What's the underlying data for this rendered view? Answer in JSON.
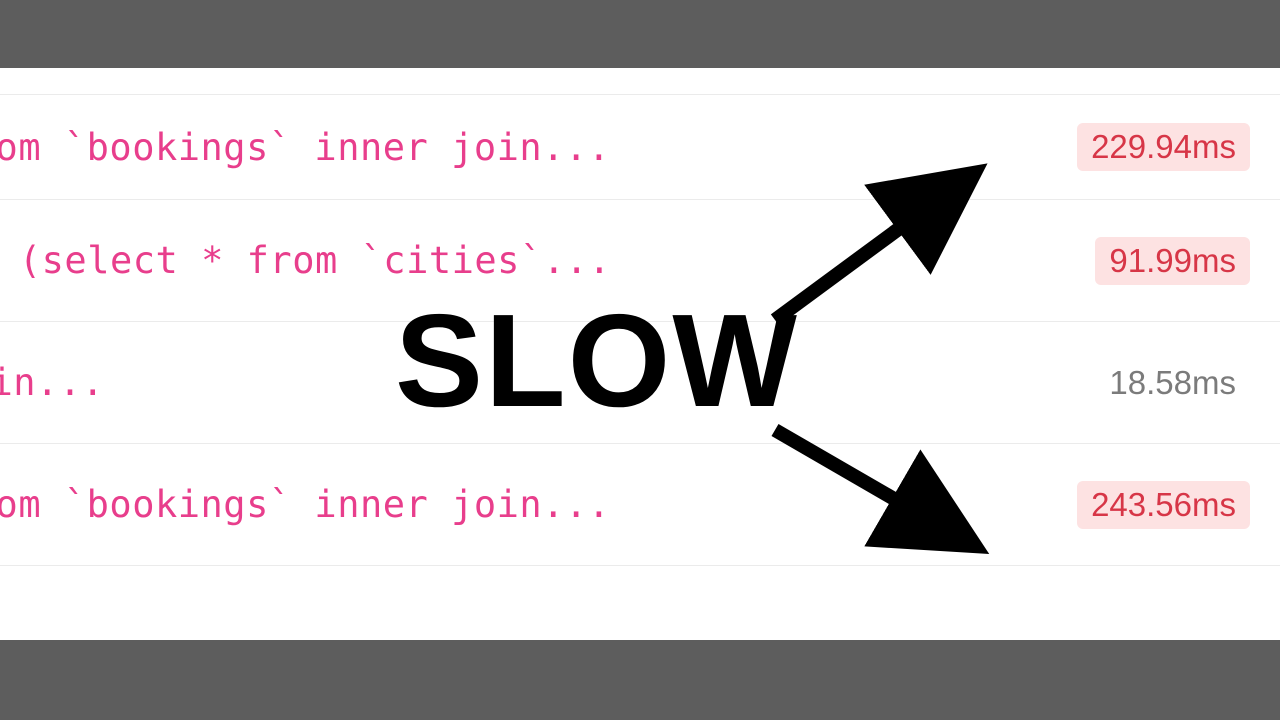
{
  "rows": [
    {
      "query": "  from `bookings` inner join...",
      "time": "229.94ms",
      "slow": true
    },
    {
      "query": " ists (select * from `cities`...",
      "time": "91.99ms",
      "slow": true
    },
    {
      "query": "s` inner join...",
      "time": "18.58ms",
      "slow": false
    },
    {
      "query": "  from `bookings` inner join...",
      "time": "243.56ms",
      "slow": true
    }
  ],
  "overlay": {
    "label": "SLOW"
  }
}
